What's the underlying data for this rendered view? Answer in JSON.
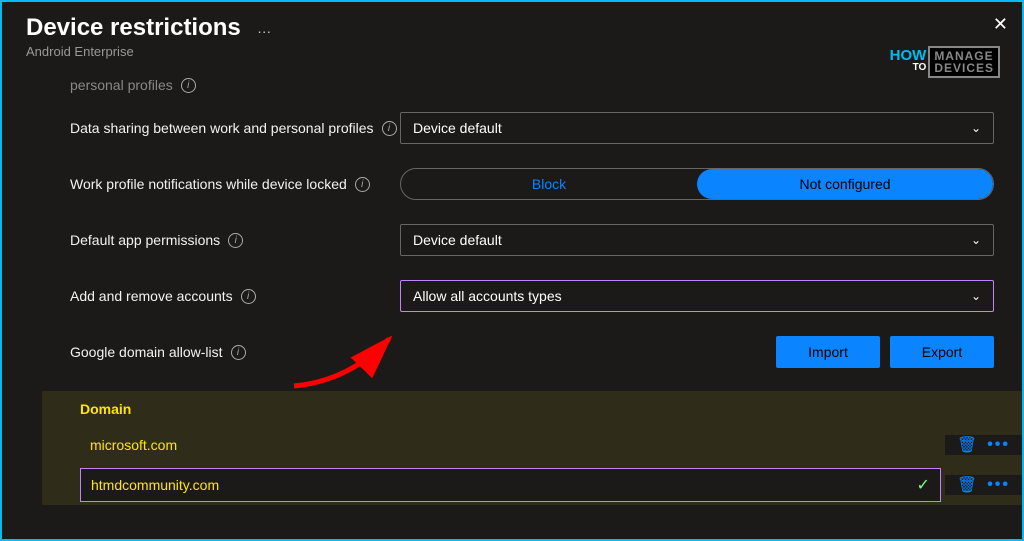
{
  "header": {
    "title": "Device restrictions",
    "subtitle": "Android Enterprise",
    "more": "···"
  },
  "logo": {
    "how": "HOW",
    "to": "TO",
    "box": "MANAGE\nDEVICES"
  },
  "cutoff": {
    "label": "personal profiles",
    "info": "i"
  },
  "rows": {
    "datasharing": {
      "label": "Data sharing between work and personal profiles",
      "info": "i",
      "value": "Device default"
    },
    "notifications": {
      "label": "Work profile notifications while device locked",
      "info": "i",
      "option_block": "Block",
      "option_notconfig": "Not configured"
    },
    "defaultperms": {
      "label": "Default app permissions",
      "info": "i",
      "value": "Device default"
    },
    "accounts": {
      "label": "Add and remove accounts",
      "info": "i",
      "value": "Allow all accounts types"
    },
    "allowlist": {
      "label": "Google domain allow-list",
      "info": "i",
      "import": "Import",
      "export": "Export"
    }
  },
  "domain_table": {
    "header": "Domain",
    "rows": [
      {
        "value": "microsoft.com",
        "editing": false
      },
      {
        "value": "htmdcommunity.com",
        "editing": true
      }
    ]
  },
  "icons": {
    "chevron": "⌄",
    "check": "✓",
    "trash": "🗑",
    "more": "•••",
    "close": "✕"
  }
}
